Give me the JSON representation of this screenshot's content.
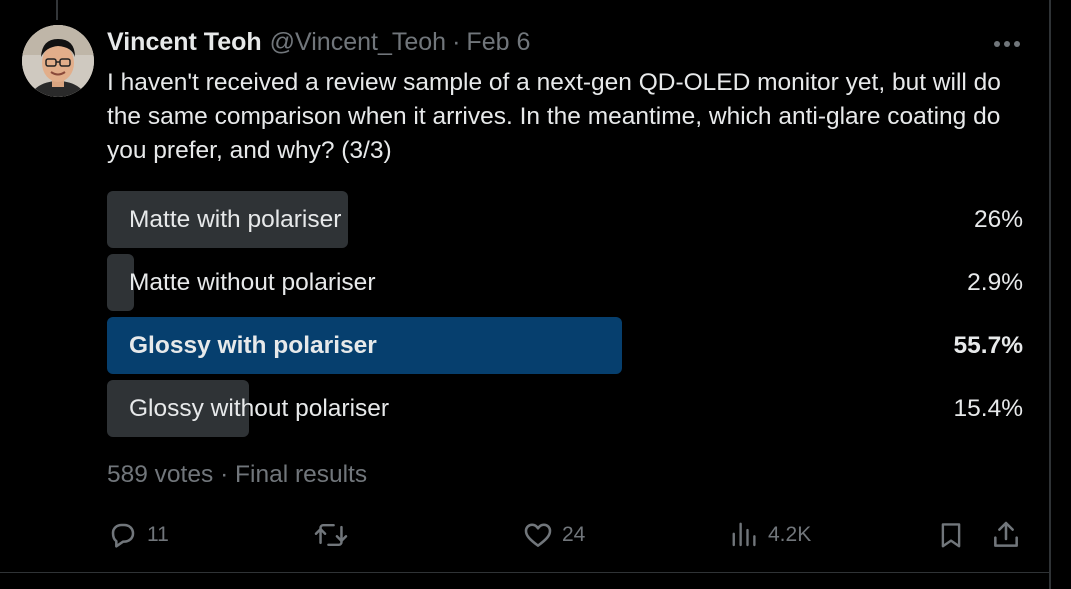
{
  "tweet": {
    "author": {
      "display_name": "Vincent Teoh",
      "handle": "@Vincent_Teoh"
    },
    "separator": "·",
    "date": "Feb 6",
    "text": "I haven't received a review sample of a next-gen QD-OLED monitor yet, but will do the same comparison when it arrives. In the meantime, which anti-glare coating do you prefer, and why? (3/3)"
  },
  "poll": {
    "options": [
      {
        "label": "Matte with polariser",
        "percent_label": "26%",
        "percent": 26,
        "winner": false
      },
      {
        "label": "Matte without polariser",
        "percent_label": "2.9%",
        "percent": 2.9,
        "winner": false
      },
      {
        "label": "Glossy with polariser",
        "percent_label": "55.7%",
        "percent": 55.7,
        "winner": true
      },
      {
        "label": "Glossy without polariser",
        "percent_label": "15.4%",
        "percent": 15.4,
        "winner": false
      }
    ],
    "votes": "589 votes",
    "separator": "·",
    "status": "Final results"
  },
  "actions": {
    "replies": "11",
    "retweets": "",
    "likes": "24",
    "views": "4.2K"
  },
  "icons": {
    "more": "more-horizontal-icon",
    "reply": "reply-bubble-icon",
    "retweet": "retweet-icon",
    "like": "heart-icon",
    "views": "views-bar-chart-icon",
    "bookmark": "bookmark-icon",
    "share": "share-upload-icon"
  },
  "colors": {
    "background": "#000000",
    "text_primary": "#e7e9ea",
    "text_secondary": "#71767b",
    "poll_bar": "#2f3336",
    "poll_bar_winner": "#063f6e",
    "border": "#2f3336"
  }
}
